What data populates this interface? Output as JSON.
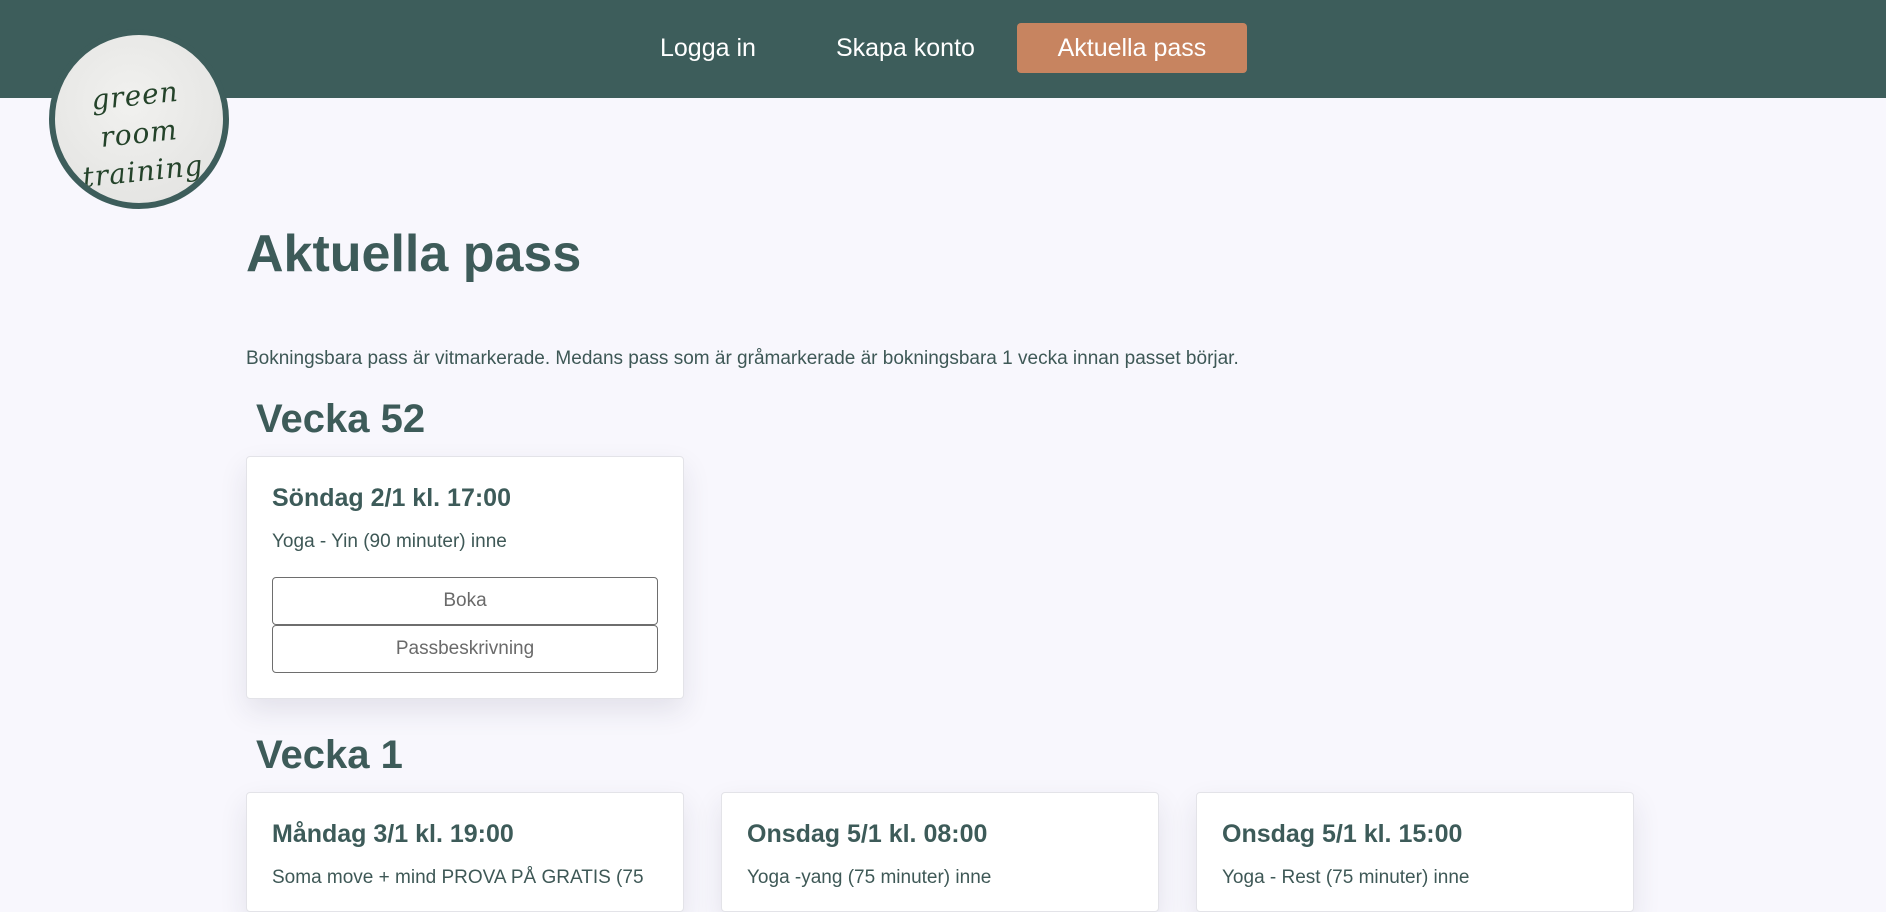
{
  "nav": {
    "login": "Logga in",
    "create_account": "Skapa konto",
    "current_classes": "Aktuella pass"
  },
  "logo": {
    "line1": "green room",
    "line2": "training"
  },
  "page": {
    "title": "Aktuella pass",
    "info": "Bokningsbara pass är vitmarkerade. Medans pass som är gråmarkerade är bokningsbara 1 vecka innan passet börjar."
  },
  "weeks": [
    {
      "label": "Vecka 52",
      "sessions": [
        {
          "date": "Söndag 2/1 kl. 17:00",
          "name": "Yoga - Yin (90 minuter) inne",
          "book_label": "Boka",
          "desc_label": "Passbeskrivning"
        }
      ]
    },
    {
      "label": "Vecka 1",
      "sessions": [
        {
          "date": "Måndag 3/1 kl. 19:00",
          "name": "Soma move + mind PROVA PÅ GRATIS (75"
        },
        {
          "date": "Onsdag 5/1 kl. 08:00",
          "name": "Yoga -yang (75 minuter) inne"
        },
        {
          "date": "Onsdag 5/1 kl. 15:00",
          "name": "Yoga - Rest (75 minuter) inne"
        }
      ]
    }
  ]
}
